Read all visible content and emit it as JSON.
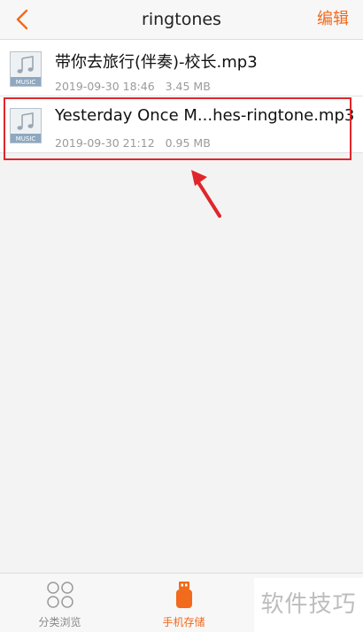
{
  "header": {
    "title": "ringtones",
    "edit_label": "编辑"
  },
  "files": [
    {
      "name": "带你去旅行(伴奏)-校长.mp3",
      "date": "2019-09-30 18:46",
      "size": "3.45 MB",
      "badge": "MUSIC"
    },
    {
      "name": "Yesterday Once M...hes-ringtone.mp3",
      "date": "2019-09-30 21:12",
      "size": "0.95 MB",
      "badge": "MUSIC"
    }
  ],
  "tabs": {
    "browse_label": "分类浏览",
    "storage_label": "手机存储"
  },
  "watermark": "软件技巧",
  "colors": {
    "accent": "#f26a1b",
    "highlight": "#e0262b"
  },
  "icons": {
    "back": "chevron-left-icon",
    "file": "music-file-icon",
    "browse": "four-circles-icon",
    "storage": "usb-storage-icon"
  }
}
